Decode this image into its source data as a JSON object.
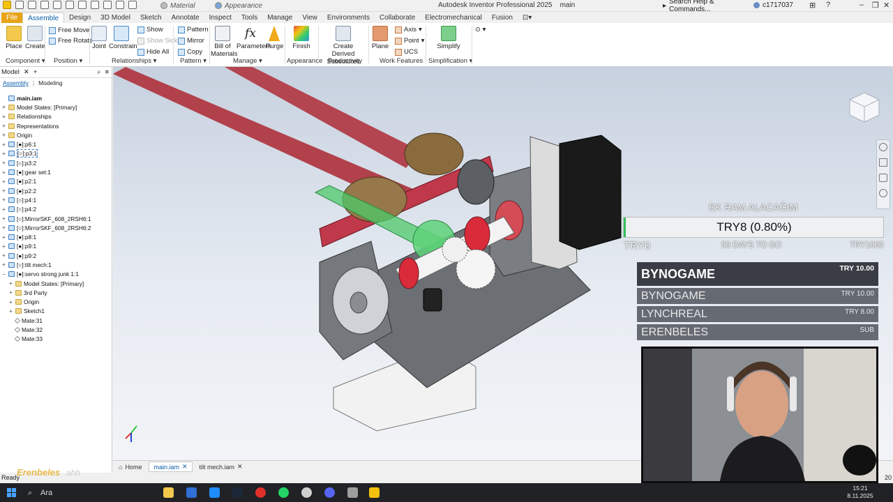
{
  "titlebar": {
    "material_placeholder": "Material",
    "appearance_placeholder": "Appearance",
    "app_title": "Autodesk Inventor Professional 2025",
    "doc_name": "main",
    "search_help": "Search Help & Commands...",
    "user": "c1717037"
  },
  "ribbon_tabs": [
    "File",
    "Assemble",
    "Design",
    "3D Model",
    "Sketch",
    "Annotate",
    "Inspect",
    "Tools",
    "Manage",
    "View",
    "Environments",
    "Collaborate",
    "Electromechanical",
    "Fusion"
  ],
  "ribbon": {
    "place": "Place",
    "create": "Create",
    "free_move": "Free Move",
    "free_rotate": "Free Rotate",
    "joint": "Joint",
    "constrain": "Constrain",
    "show": "Show",
    "show_sick": "Show Sick",
    "hide_all": "Hide All",
    "pattern": "Pattern",
    "mirror": "Mirror",
    "copy": "Copy",
    "bom_line1": "Bill of",
    "bom_line2": "Materials",
    "parameters": "Parameters",
    "purge": "Purge",
    "finish": "Finish",
    "derived_line1": "Create Derived",
    "derived_line2": "Substitutes",
    "plane": "Plane",
    "axis": "Axis",
    "point": "Point",
    "ucs": "UCS",
    "simplify": "Simplify",
    "panels": {
      "component": "Component",
      "position": "Position",
      "relationships": "Relationships",
      "pattern": "Pattern",
      "manage": "Manage",
      "appearance": "Appearance",
      "productivity": "Productivity",
      "work_features": "Work Features",
      "simplification": "Simplification"
    }
  },
  "browser": {
    "title": "Model",
    "tab_assembly": "Assembly",
    "tab_modeling": "Modeling",
    "tree": [
      {
        "label": "main.iam",
        "indent": 0,
        "exp": "",
        "icon": "asm",
        "root": true
      },
      {
        "label": "Model States: [Primary]",
        "indent": 0,
        "exp": "+",
        "icon": "fold"
      },
      {
        "label": "Relationships",
        "indent": 0,
        "exp": "+",
        "icon": "fold"
      },
      {
        "label": "Representations",
        "indent": 0,
        "exp": "+",
        "icon": "fold"
      },
      {
        "label": "Origin",
        "indent": 0,
        "exp": "+",
        "icon": "fold"
      },
      {
        "label": "[●]:p6:1",
        "indent": 0,
        "exp": "+",
        "icon": "part"
      },
      {
        "label": "[○]:p3:1",
        "indent": 0,
        "exp": "+",
        "icon": "part",
        "sel": true
      },
      {
        "label": "[○]:p3:2",
        "indent": 0,
        "exp": "+",
        "icon": "part"
      },
      {
        "label": "[●]:gear set:1",
        "indent": 0,
        "exp": "+",
        "icon": "part"
      },
      {
        "label": "[●]:p2:1",
        "indent": 0,
        "exp": "+",
        "icon": "part"
      },
      {
        "label": "[●]:p2:2",
        "indent": 0,
        "exp": "+",
        "icon": "part"
      },
      {
        "label": "[○]:p4:1",
        "indent": 0,
        "exp": "+",
        "icon": "part"
      },
      {
        "label": "[○]:p4:2",
        "indent": 0,
        "exp": "+",
        "icon": "part"
      },
      {
        "label": "[○]:MirrorSKF_608_2RSH6:1",
        "indent": 0,
        "exp": "+",
        "icon": "part"
      },
      {
        "label": "[○]:MirrorSKF_608_2RSH6:2",
        "indent": 0,
        "exp": "+",
        "icon": "part"
      },
      {
        "label": "[●]:p8:1",
        "indent": 0,
        "exp": "+",
        "icon": "part"
      },
      {
        "label": "[●]:p9:1",
        "indent": 0,
        "exp": "+",
        "icon": "part"
      },
      {
        "label": "[●]:p9:2",
        "indent": 0,
        "exp": "+",
        "icon": "part"
      },
      {
        "label": "[○]:tilt mech:1",
        "indent": 0,
        "exp": "+",
        "icon": "part"
      },
      {
        "label": "[●]:servo strong junk 1:1",
        "indent": 0,
        "exp": "−",
        "icon": "part"
      },
      {
        "label": "Model States: [Primary]",
        "indent": 1,
        "exp": "+",
        "icon": "fold"
      },
      {
        "label": "3rd Party",
        "indent": 1,
        "exp": "+",
        "icon": "fold"
      },
      {
        "label": "Origin",
        "indent": 1,
        "exp": "+",
        "icon": "fold"
      },
      {
        "label": "Sketch1",
        "indent": 1,
        "exp": "+",
        "icon": "fold"
      },
      {
        "label": "Mate:31",
        "indent": 1,
        "exp": "",
        "icon": "mate"
      },
      {
        "label": "Mate:32",
        "indent": 1,
        "exp": "",
        "icon": "mate"
      },
      {
        "label": "Mate:33",
        "indent": 1,
        "exp": "",
        "icon": "mate"
      }
    ]
  },
  "doc_tabs": {
    "home": "Home",
    "tab1": "main.iam",
    "tab2": "tilt mech.iam"
  },
  "status": {
    "text": "Ready",
    "count": "20"
  },
  "goal": {
    "title": "EK RAM ALACAĞIM",
    "value": "TRY8 (0.80%)",
    "progress_percent": 0.8,
    "min": "TRY0",
    "days_left": "53 DAYS TO GO",
    "max": "TRY1000"
  },
  "donations": [
    {
      "name": "BYNOGAME",
      "amount": "TRY 10.00"
    },
    {
      "name": "BYNOGAME",
      "amount": "TRY 10.00"
    },
    {
      "name": "LYNCHREAL",
      "amount": "TRY 8.00"
    },
    {
      "name": "ERENBELES",
      "amount": "SUB"
    }
  ],
  "stream_logo": {
    "main": "Erenbeles",
    "sub": "ahh"
  },
  "taskbar": {
    "search": "Ara",
    "time": "15:21",
    "date": "8.11.2025"
  }
}
